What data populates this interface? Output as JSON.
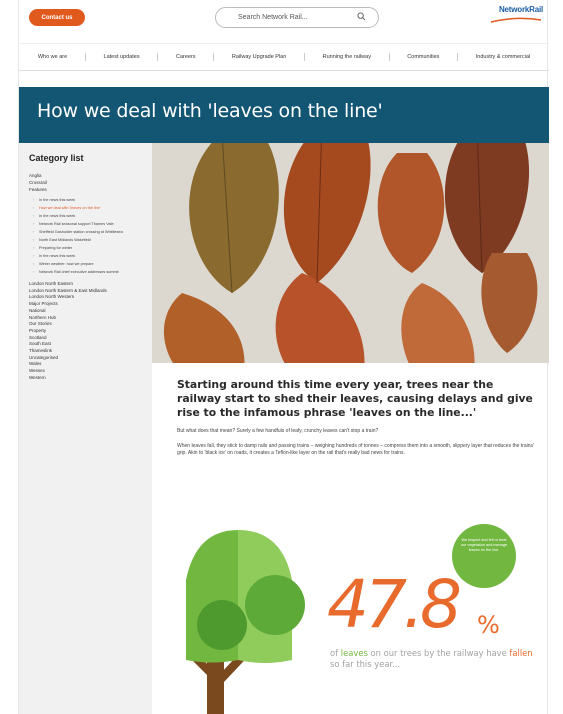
{
  "header": {
    "cta_label": "Contact us",
    "search_placeholder": "Search Network Rail...",
    "logo_text": "NetworkRail"
  },
  "nav": {
    "items": [
      "Who we are",
      "Latest updates",
      "Careers",
      "Railway Upgrade Plan",
      "Running the railway",
      "Communities",
      "Industry & commercial"
    ]
  },
  "hero": {
    "title": "How we deal with 'leaves on the line'"
  },
  "sidebar": {
    "title": "Category list",
    "top_items": [
      "Anglia",
      "Crossrail",
      "Features"
    ],
    "sub_items": [
      "In the news this week",
      "How we deal with 'leaves on the line'",
      "In the news this week",
      "Network Rail seasonal support Thames Vale",
      "Sheffield Gasholder station crossing at Whittlesea",
      "North East Midlands Wakefield",
      "Preparing for winter",
      "In the news this week",
      "Winter weather: how we prepare",
      "Network Rail chief executive addresses summit"
    ],
    "active_index": 1,
    "regions": [
      "London North Eastern",
      "London North Eastern & East Midlands",
      "London North Western",
      "Major Projects",
      "National",
      "Northern Hub",
      "Our Stories",
      "Property",
      "Scotland",
      "South East",
      "Thameslink",
      "Uncategorised",
      "Wales",
      "Wessex",
      "Western"
    ]
  },
  "article": {
    "headline": "Starting around this time every year, trees near the railway start to shed their leaves, causing delays and give rise to the infamous phrase 'leaves on the line...'",
    "para1": "But what does that mean? Surely a few handfuls of leafy, crunchy leaves can't stop a train?",
    "para2": "When leaves fall, they stick to damp rails and passing trains – weighing hundreds of tonnes – compress them into a smooth, slippery layer that reduces the trains' grip. Akin to 'black ice' on roads, it creates a Teflon-like layer on the rail that's really bad news for trains."
  },
  "infographic": {
    "percent": "47.8",
    "percent_sign": "%",
    "caption_1": "of",
    "caption_leaves": "leaves",
    "caption_2": "on our trees by the railway have",
    "caption_fallen": "fallen",
    "caption_3": "so far this year...",
    "bubble_text": "We inspect and fell or treat our vegetation and manage leaves on the line.",
    "colors": {
      "orange": "#e86a2c",
      "green": "#72b840",
      "trunk": "#7a4a1e"
    }
  }
}
